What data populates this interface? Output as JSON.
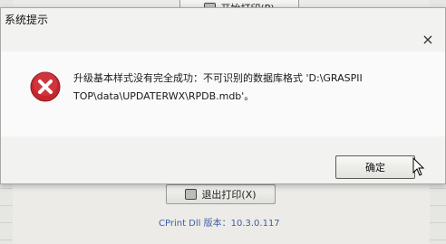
{
  "background": {
    "print_button_label": "开始打印(P)",
    "exit_button_label": "退出打印(X)",
    "version_text": "CPrint Dll 版本：10.3.0.117"
  },
  "dialog": {
    "title": "系统提示",
    "close_glyph": "×",
    "icon": "error-icon",
    "message": "升级基本样式没有完全成功：不可识别的数据库格式 'D:\\GRASPII\nTOP\\data\\UPDATERWX\\RPDB.mdb'。",
    "ok_label": "确定"
  },
  "colors": {
    "error_red": "#c4262e",
    "version_blue": "#3b5fa8"
  }
}
